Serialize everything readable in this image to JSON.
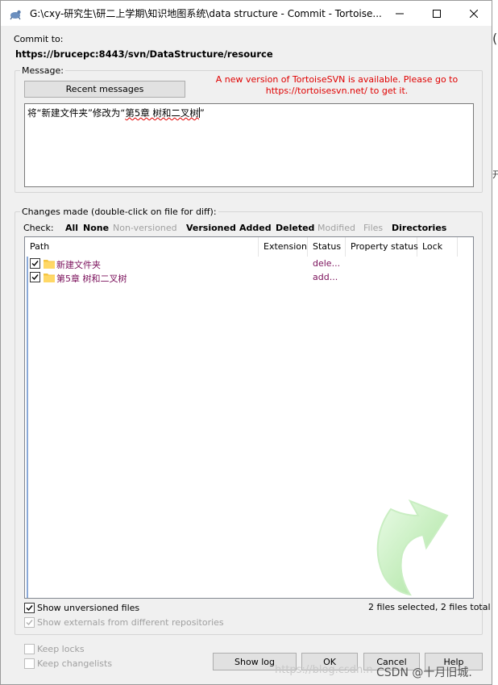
{
  "window": {
    "title": "G:\\cxy-研究生\\研二上学期\\知识地图系统\\data structure - Commit - Tortoise...",
    "icons": {
      "app": "tortoise-icon",
      "minimize": "minimize-icon",
      "maximize": "maximize-icon",
      "close": "close-icon"
    }
  },
  "commit_to": {
    "label": "Commit to:",
    "url": "https://brucepc:8443/svn/DataStructure/resource"
  },
  "message": {
    "group_label": "Message:",
    "recent_button": "Recent messages",
    "notice_line1": "A new version of TortoiseSVN is available. Please go to",
    "notice_line2": "https://tortoisesvn.net/ to get it.",
    "notice_color": "#e00000",
    "text_part1": "将“新建文件夹”修改为“",
    "text_part2": "第5章  树和二叉树",
    "text_part3": "”"
  },
  "changes": {
    "group_label": "Changes made (double-click on file for diff):",
    "check_label": "Check:",
    "filters": [
      {
        "label": "All",
        "enabled": true
      },
      {
        "label": "None",
        "enabled": true
      },
      {
        "label": "Non-versioned",
        "enabled": false
      },
      {
        "label": "Versioned",
        "enabled": true
      },
      {
        "label": "Added",
        "enabled": true
      },
      {
        "label": "Deleted",
        "enabled": true
      },
      {
        "label": "Modified",
        "enabled": false
      },
      {
        "label": "Files",
        "enabled": false
      },
      {
        "label": "Directories",
        "enabled": true
      }
    ],
    "columns": [
      "Path",
      "Extension",
      "Status",
      "Property status",
      "Lock"
    ],
    "rows": [
      {
        "path": "新建文件夹",
        "extension": "",
        "status": "dele...",
        "checked": true,
        "icon": "folder-icon"
      },
      {
        "path": "第5章 树和二叉树",
        "extension": "",
        "status": "add...",
        "checked": true,
        "icon": "folder-icon"
      }
    ],
    "watermark_icon": "commit-arrow-icon"
  },
  "options": {
    "show_unversioned": "Show unversioned files",
    "show_externals": "Show externals from different repositories",
    "keep_locks": "Keep locks",
    "keep_changelists": "Keep changelists",
    "selection_summary": "2 files selected, 2 files total"
  },
  "buttons": {
    "show_log": "Show log",
    "ok": "OK",
    "cancel": "Cancel",
    "help": "Help"
  },
  "overlay": {
    "blog_watermark": "https://blog.csdn.n",
    "csdn_tag": "CSDN @十月旧城."
  },
  "background": {
    "glyph1": "(",
    "glyph2": "开"
  }
}
